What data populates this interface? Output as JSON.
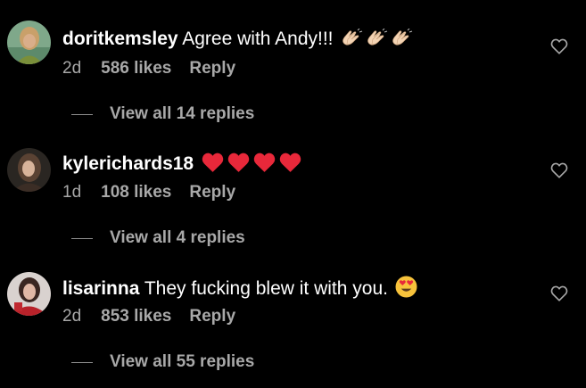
{
  "comments": [
    {
      "username": "doritkemsley",
      "text": "Agree with Andy!!!",
      "emoji": [
        "clapping-hands",
        "clapping-hands",
        "clapping-hands"
      ],
      "time": "2d",
      "likes": "586 likes",
      "reply_label": "Reply",
      "view_replies": "View all 14 replies"
    },
    {
      "username": "kylerichards18",
      "text": "",
      "emoji": [
        "red-heart",
        "red-heart",
        "red-heart",
        "red-heart"
      ],
      "time": "1d",
      "likes": "108 likes",
      "reply_label": "Reply",
      "view_replies": "View all 4 replies"
    },
    {
      "username": "lisarinna",
      "text": "They fucking blew it with you.",
      "emoji": [
        "heart-eyes-face"
      ],
      "time": "2d",
      "likes": "853 likes",
      "reply_label": "Reply",
      "view_replies": "View all 55 replies"
    }
  ],
  "colors": {
    "background": "#000000",
    "primary_text": "#ffffff",
    "secondary_text": "#a8a8a8",
    "heart_emoji": "#e8283a",
    "face_emoji": "#f7c23b"
  }
}
